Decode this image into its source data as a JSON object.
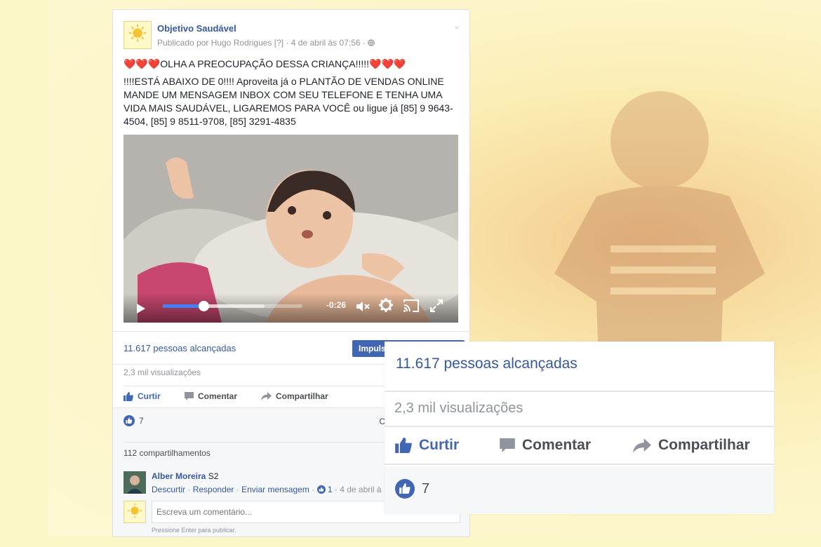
{
  "post": {
    "page_name": "Objetivo Saudável",
    "published_by": "Publicado por Hugo Rodrigues",
    "help_marker": "[?]",
    "timestamp": "· 4 de abril às 07:56 ·",
    "text_line1": "❤️❤️❤️OLHA A PREOCUPAÇÃO DESSA CRIANÇA!!!!!❤️❤️❤️",
    "text_body": "!!!!ESTÁ ABAIXO DE 0!!!! Aproveita já o PLANTÃO DE VENDAS ONLINE MANDE UM MENSAGEM INBOX COM SEU TELEFONE E TENHA UMA VIDA MAIS SAUDÁVEL, LIGAREMOS PARA VOCÊ ou ligue já [85] 9 9643-4504, [85] 9 8511-9708, [85] 3291-4835"
  },
  "video": {
    "time_remaining": "-0:26",
    "played_fraction": 0.29,
    "buffered_fraction": 0.73
  },
  "stats": {
    "reach": "11.617 pessoas alcançadas",
    "boost_label": "Impulsionar publicação",
    "views": "2,3 mil visualizações",
    "like_count": "7",
    "right_cut": "C",
    "shares": "112 compartilhamentos"
  },
  "actions": {
    "like": "Curtir",
    "comment": "Comentar",
    "share": "Compartilhar"
  },
  "comment": {
    "author": "Alber Moreira",
    "text": "S2",
    "unlike": "Descurtir",
    "reply": "Responder",
    "send_message": "Enviar mensagem",
    "likes": "1",
    "time": "4 de abril à"
  },
  "composer": {
    "placeholder": "Escreva um comentário...",
    "hint": "Pressione Enter para publicar."
  },
  "colors": {
    "link_blue": "#365899",
    "like_blue": "#4267b2",
    "progress_blue": "#4080ff"
  },
  "icons": [
    "heart-icon",
    "globe-icon",
    "chevron-down-icon",
    "play-icon",
    "mute-icon",
    "settings-icon",
    "cast-icon",
    "fullscreen-icon",
    "like-icon",
    "comment-icon",
    "share-icon"
  ]
}
